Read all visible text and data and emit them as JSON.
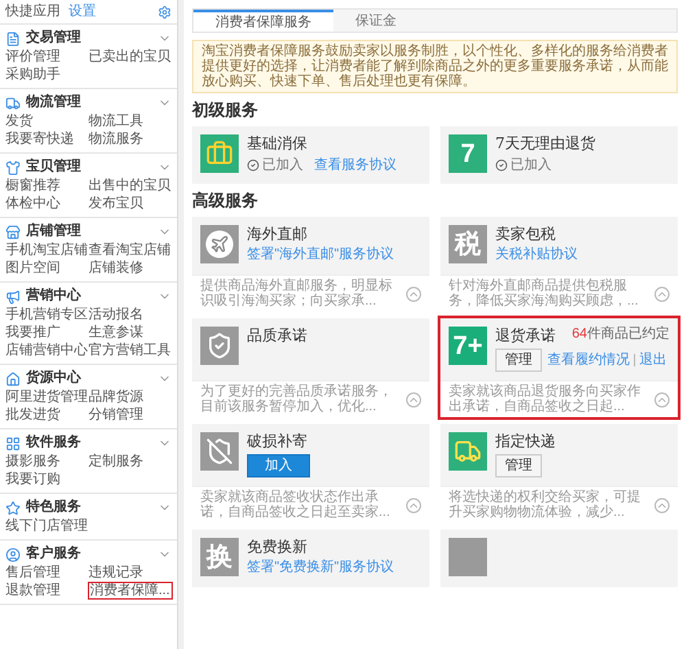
{
  "sidebar": {
    "title": "快捷应用",
    "settings_link": "设置",
    "sections": [
      {
        "title": "交易管理",
        "expanded": true,
        "items": [
          {
            "label": "评价管理",
            "selected": false
          },
          {
            "label": "已卖出的宝贝",
            "selected": false
          },
          {
            "label": "采购助手",
            "selected": false
          }
        ]
      },
      {
        "title": "物流管理",
        "expanded": true,
        "items": [
          {
            "label": "发货",
            "selected": false
          },
          {
            "label": "物流工具",
            "selected": false
          },
          {
            "label": "我要寄快递",
            "selected": false
          },
          {
            "label": "物流服务",
            "selected": false
          }
        ]
      },
      {
        "title": "宝贝管理",
        "expanded": true,
        "items": [
          {
            "label": "橱窗推荐",
            "selected": false
          },
          {
            "label": "出售中的宝贝",
            "selected": false
          },
          {
            "label": "体检中心",
            "selected": false
          },
          {
            "label": "发布宝贝",
            "selected": false
          }
        ]
      },
      {
        "title": "店铺管理",
        "expanded": true,
        "items": [
          {
            "label": "手机淘宝店铺",
            "selected": false
          },
          {
            "label": "查看淘宝店铺",
            "selected": false
          },
          {
            "label": "图片空间",
            "selected": false
          },
          {
            "label": "店铺装修",
            "selected": false
          }
        ]
      },
      {
        "title": "营销中心",
        "expanded": true,
        "items": [
          {
            "label": "手机营销专区",
            "selected": false
          },
          {
            "label": "活动报名",
            "selected": false
          },
          {
            "label": "我要推广",
            "selected": false
          },
          {
            "label": "生意参谋",
            "selected": false
          },
          {
            "label": "店铺营销中心",
            "selected": false
          },
          {
            "label": "官方营销工具",
            "selected": false
          }
        ]
      },
      {
        "title": "货源中心",
        "expanded": true,
        "items": [
          {
            "label": "阿里进货管理",
            "selected": false
          },
          {
            "label": "品牌货源",
            "selected": false
          },
          {
            "label": "批发进货",
            "selected": false
          },
          {
            "label": "分销管理",
            "selected": false
          }
        ]
      },
      {
        "title": "软件服务",
        "expanded": true,
        "items": [
          {
            "label": "摄影服务",
            "selected": false
          },
          {
            "label": "定制服务",
            "selected": false
          },
          {
            "label": "我要订购",
            "selected": false
          }
        ]
      },
      {
        "title": "特色服务",
        "expanded": true,
        "items": [
          {
            "label": "线下门店管理",
            "selected": false
          }
        ]
      },
      {
        "title": "客户服务",
        "expanded": true,
        "items": [
          {
            "label": "售后管理",
            "selected": false
          },
          {
            "label": "违规记录",
            "selected": false
          },
          {
            "label": "退款管理",
            "selected": false
          },
          {
            "label": "消费者保障...",
            "selected": true
          }
        ]
      }
    ]
  },
  "tabs": [
    {
      "label": "消费者保障服务",
      "selected": true
    },
    {
      "label": "保证金",
      "selected": false
    }
  ],
  "notice": "淘宝消费者保障服务鼓励卖家以服务制胜，以个性化、多样化的服务给消费者提供更好的选择，让消费者能了解到除商品之外的更多重要服务承诺，从而能放心购买、快速下单、售后处理也更有保障。",
  "basic_services": {
    "heading": "初级服务",
    "cards": [
      {
        "title": "基础消保",
        "icon": {
          "kind": "bag",
          "color": "#2db07c"
        },
        "status": "已加入",
        "links": [
          "查看服务协议"
        ]
      },
      {
        "title": "7天无理由退货",
        "icon": {
          "kind": "glyph",
          "text": "7",
          "color": "#2db07c"
        },
        "status": "已加入"
      }
    ]
  },
  "advanced_services": {
    "heading": "高级服务",
    "cards": [
      {
        "kind": "service",
        "title": "海外直邮",
        "icon": {
          "kind": "plane",
          "color": "#9a9a9a"
        },
        "links": [
          "签署\"海外直邮\"服务协议"
        ],
        "description": "提供商品海外直邮服务，明显标识吸引海淘买家；向买家承...",
        "highlighted": false
      },
      {
        "kind": "service",
        "title": "卖家包税",
        "icon": {
          "kind": "glyph",
          "text": "税",
          "color": "#9a9a9a"
        },
        "links": [
          "关税补贴协议"
        ],
        "description": "针对海外直邮商品提供包税服务，降低买家海淘购买顾虑，...",
        "highlighted": false
      },
      {
        "kind": "service",
        "title": "品质承诺",
        "icon": {
          "kind": "shield",
          "color": "#9a9a9a"
        },
        "description": "为了更好的完善品质承诺服务，目前该服务暂停加入，优化...",
        "highlighted": false
      },
      {
        "kind": "service",
        "title": "退货承诺",
        "icon": {
          "kind": "glyph",
          "text": "7+",
          "color": "#1aae7a"
        },
        "note": {
          "count": "64",
          "text": "件商品已约定"
        },
        "button": {
          "label": "管理",
          "primary": false
        },
        "links": [
          "查看履约情况",
          "退出"
        ],
        "description": "卖家就该商品退货服务向买家作出承诺，自商品签收之日起...",
        "highlighted": true
      },
      {
        "kind": "service",
        "title": "破损补寄",
        "icon": {
          "kind": "cracked-shield",
          "color": "#9a9a9a"
        },
        "button": {
          "label": "加入",
          "primary": true
        },
        "description": "卖家就该商品签收状态作出承诺，自商品签收之日起至卖家...",
        "highlighted": false
      },
      {
        "kind": "service",
        "title": "指定快递",
        "icon": {
          "kind": "truck",
          "color": "#2db07c"
        },
        "button": {
          "label": "管理",
          "primary": false
        },
        "description": "将选快递的权利交给买家，可提升买家购物物流体验，减少...",
        "highlighted": false
      },
      {
        "kind": "service",
        "title": "免费换新",
        "icon": {
          "kind": "glyph",
          "text": "换",
          "color": "#9a9a9a"
        },
        "links": [
          "签署\"免费换新\"服务协议"
        ],
        "highlighted": false
      },
      {
        "kind": "covered",
        "icon": {
          "kind": "blank",
          "color": "#9a9a9a"
        },
        "highlighted": false
      }
    ]
  }
}
